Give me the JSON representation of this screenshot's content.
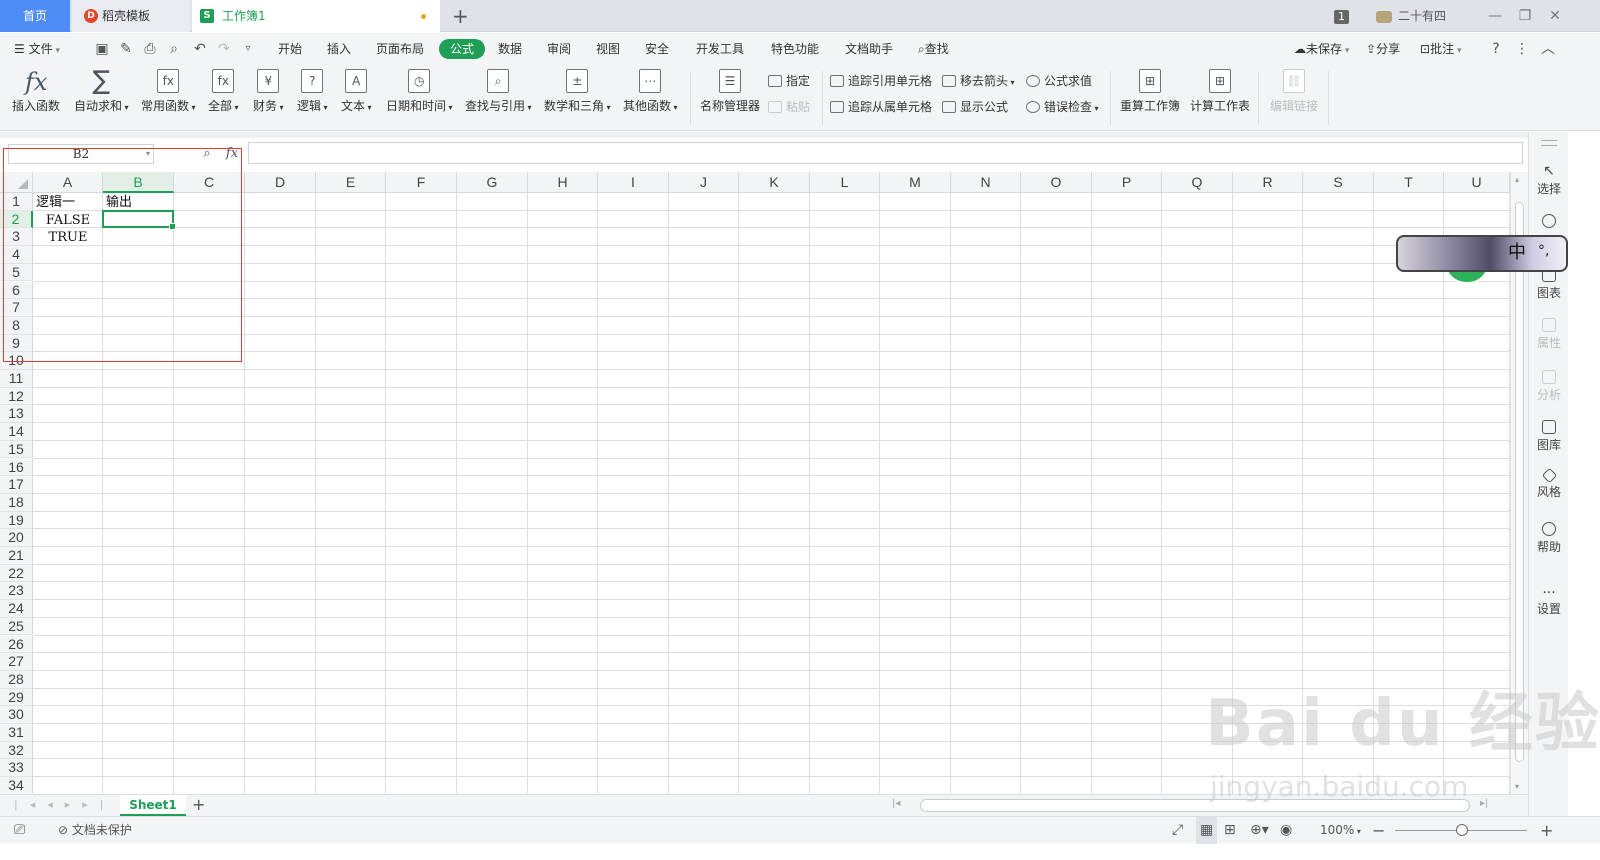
{
  "tabs": {
    "home": "首页",
    "template": "稻壳模板",
    "workbook": "工作簿1",
    "new": "+"
  },
  "titlebar": {
    "count_badge": "1",
    "user": "二十有四"
  },
  "menu": {
    "file": "文件",
    "items": [
      "开始",
      "插入",
      "页面布局",
      "公式",
      "数据",
      "审阅",
      "视图",
      "安全",
      "开发工具",
      "特色功能",
      "文档助手"
    ],
    "active": "公式",
    "search": "查找",
    "unsaved": "未保存",
    "share": "分享",
    "comment": "批注"
  },
  "ribbon": {
    "insert_func": "插入函数",
    "autosum": "自动求和",
    "common_func": "常用函数",
    "all": "全部",
    "finance": "财务",
    "logic": "逻辑",
    "text": "文本",
    "datetime": "日期和时间",
    "lookup": "查找与引用",
    "math": "数学和三角",
    "other": "其他函数",
    "name_mgr": "名称管理器",
    "assign": "指定",
    "paste": "粘贴",
    "trace_prec": "追踪引用单元格",
    "trace_dep": "追踪从属单元格",
    "remove_arrow": "移去箭头",
    "show_formula": "显示公式",
    "eval_formula": "公式求值",
    "error_check": "错误检查",
    "recalc_book": "重算工作簿",
    "calc_sheet": "计算工作表",
    "edit_links": "编辑链接"
  },
  "formula_bar": {
    "name_box": "B2",
    "fx": "fx",
    "value": ""
  },
  "grid": {
    "columns": [
      "A",
      "B",
      "C",
      "D",
      "E",
      "F",
      "G",
      "H",
      "I",
      "J",
      "K",
      "L",
      "M",
      "N",
      "O",
      "P",
      "Q",
      "R",
      "S",
      "T",
      "U"
    ],
    "rows": [
      "1",
      "2",
      "3",
      "4",
      "5",
      "6",
      "7",
      "8",
      "9",
      "10",
      "11",
      "12",
      "13",
      "14",
      "15",
      "16",
      "17",
      "18",
      "19",
      "20",
      "21",
      "22",
      "23",
      "24",
      "25",
      "26",
      "27",
      "28",
      "29",
      "30",
      "31",
      "32",
      "33",
      "34"
    ],
    "selected_col": "B",
    "selected_row": "2",
    "cells": {
      "A1": "逻辑一",
      "B1": "输出",
      "A2": "FALSE",
      "A3": "TRUE"
    }
  },
  "sheets": {
    "active": "Sheet1"
  },
  "status": {
    "protect": "文档未保护",
    "zoom": "100%"
  },
  "side": [
    "选择",
    "图表",
    "属性",
    "分析",
    "图库",
    "风格",
    "帮助",
    "设置"
  ],
  "floater": {
    "ime": "中"
  },
  "watermark": {
    "main": "Bai du 经验",
    "url": "jingyan.baidu.com"
  }
}
